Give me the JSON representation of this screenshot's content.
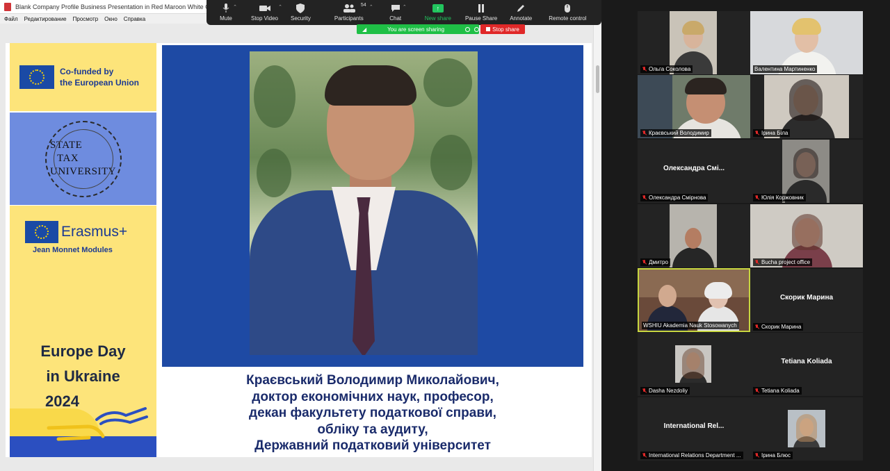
{
  "app": {
    "window_title": "Blank Company Profile Business Presentation in Red Maroon White Geometric",
    "menu": [
      "Файл",
      "Редактирование",
      "Просмотр",
      "Окно",
      "Справка"
    ]
  },
  "toolbar": {
    "mute": "Mute",
    "stop_video": "Stop Video",
    "security": "Security",
    "participants": "Participants",
    "participants_count": "54",
    "chat": "Chat",
    "new_share": "New share",
    "pause_share": "Pause Share",
    "annotate": "Annotate",
    "remote_control": "Remote control"
  },
  "share_banner": {
    "message": "You are screen sharing",
    "stop": "Stop share"
  },
  "slide": {
    "cofund_line1": "Co-funded by",
    "cofund_line2": "the European Union",
    "seal_line1": "STATE",
    "seal_line2": "TAX",
    "seal_line3": "UNIVERSITY",
    "erasmus": "Erasmus+",
    "jean_monnet": "Jean Monnet Modules",
    "europe_day_1": "Europe Day",
    "europe_day_2": "in Ukraine",
    "europe_day_3": "2024",
    "caption_1": "Краєвський Володимир Миколайович,",
    "caption_2": "доктор економічних наук, професор,",
    "caption_3": "декан факультету податкової справи,",
    "caption_4": "обліку та аудиту,",
    "caption_5": "Державний податковий університет"
  },
  "participants": [
    {
      "name": "Ольга Соколова",
      "video": true
    },
    {
      "name": "Валентина Мартиненко",
      "video": true
    },
    {
      "name": "Краєвський Володимир",
      "video": true
    },
    {
      "name": "Ірина Біла",
      "video": true
    },
    {
      "name": "Олександра Смірнова",
      "video": false,
      "center": "Олександра  Смі..."
    },
    {
      "name": "Юлія Коржовник",
      "video": true
    },
    {
      "name": "Дмитро",
      "video": true
    },
    {
      "name": "Bucha project office",
      "video": true
    },
    {
      "name": "WSHIU Akademia Nauk Stosowanych",
      "video": true
    },
    {
      "name": "Скорик Марина",
      "video": false,
      "center": "Скорик Марина"
    },
    {
      "name": "Dasha Nezdoliy",
      "video": true
    },
    {
      "name": "Tetiana Koliada",
      "video": false,
      "center": "Tetiana Koliada"
    },
    {
      "name": "International Relations Department ...",
      "video": false,
      "center": "International  Rel..."
    },
    {
      "name": "Ірина Блюс",
      "video": true
    }
  ],
  "colors": {
    "eu_blue": "#1a4aa5",
    "slide_yellow": "#fde47a",
    "slide_blue": "#1e4aa4",
    "zoom_green": "#22c55e",
    "stop_red": "#e02828"
  }
}
